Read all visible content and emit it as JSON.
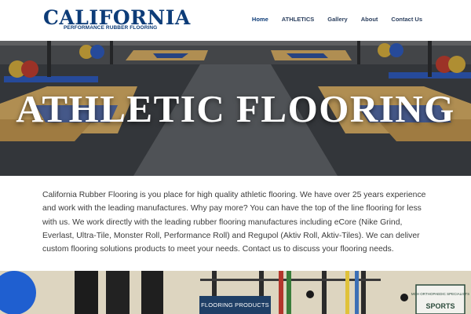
{
  "brand": {
    "name": "CALIFORNIA",
    "tagline": "PERFORMANCE RUBBER FLOORING"
  },
  "nav": {
    "items": [
      {
        "label": "Home"
      },
      {
        "label": "ATHLETICS"
      },
      {
        "label": "Gallery"
      },
      {
        "label": "About"
      },
      {
        "label": "Contact Us"
      }
    ]
  },
  "hero": {
    "title": "ATHLETIC FLOORING"
  },
  "intro": {
    "text": "California Rubber Flooring is you place for high quality athletic flooring. We have over 25 years experience and work with the leading manufactures. Why pay more? You can have the top of the line flooring for less with us. We work directly with the leading rubber flooring manufactures including eCore (Nike Grind, Everlast, Ultra-Tile, Monster Roll, Performance Roll) and Regupol (Aktiv Roll, Aktiv-Tiles).  We can deliver custom flooring solutions products to meet your needs.  Contact us to discuss your flooring needs."
  },
  "cta": {
    "label": "FLOORING PRODUCTS"
  },
  "gym_sign": {
    "line1": "MCH ORTHOPAEDIC SPECIALISTS",
    "line2": "SPORTS"
  },
  "colors": {
    "brand_blue": "#0d3c78",
    "nav_text": "#2b3f5e",
    "button_bg": "#1f3f66",
    "body_text": "#3b3b3b"
  }
}
